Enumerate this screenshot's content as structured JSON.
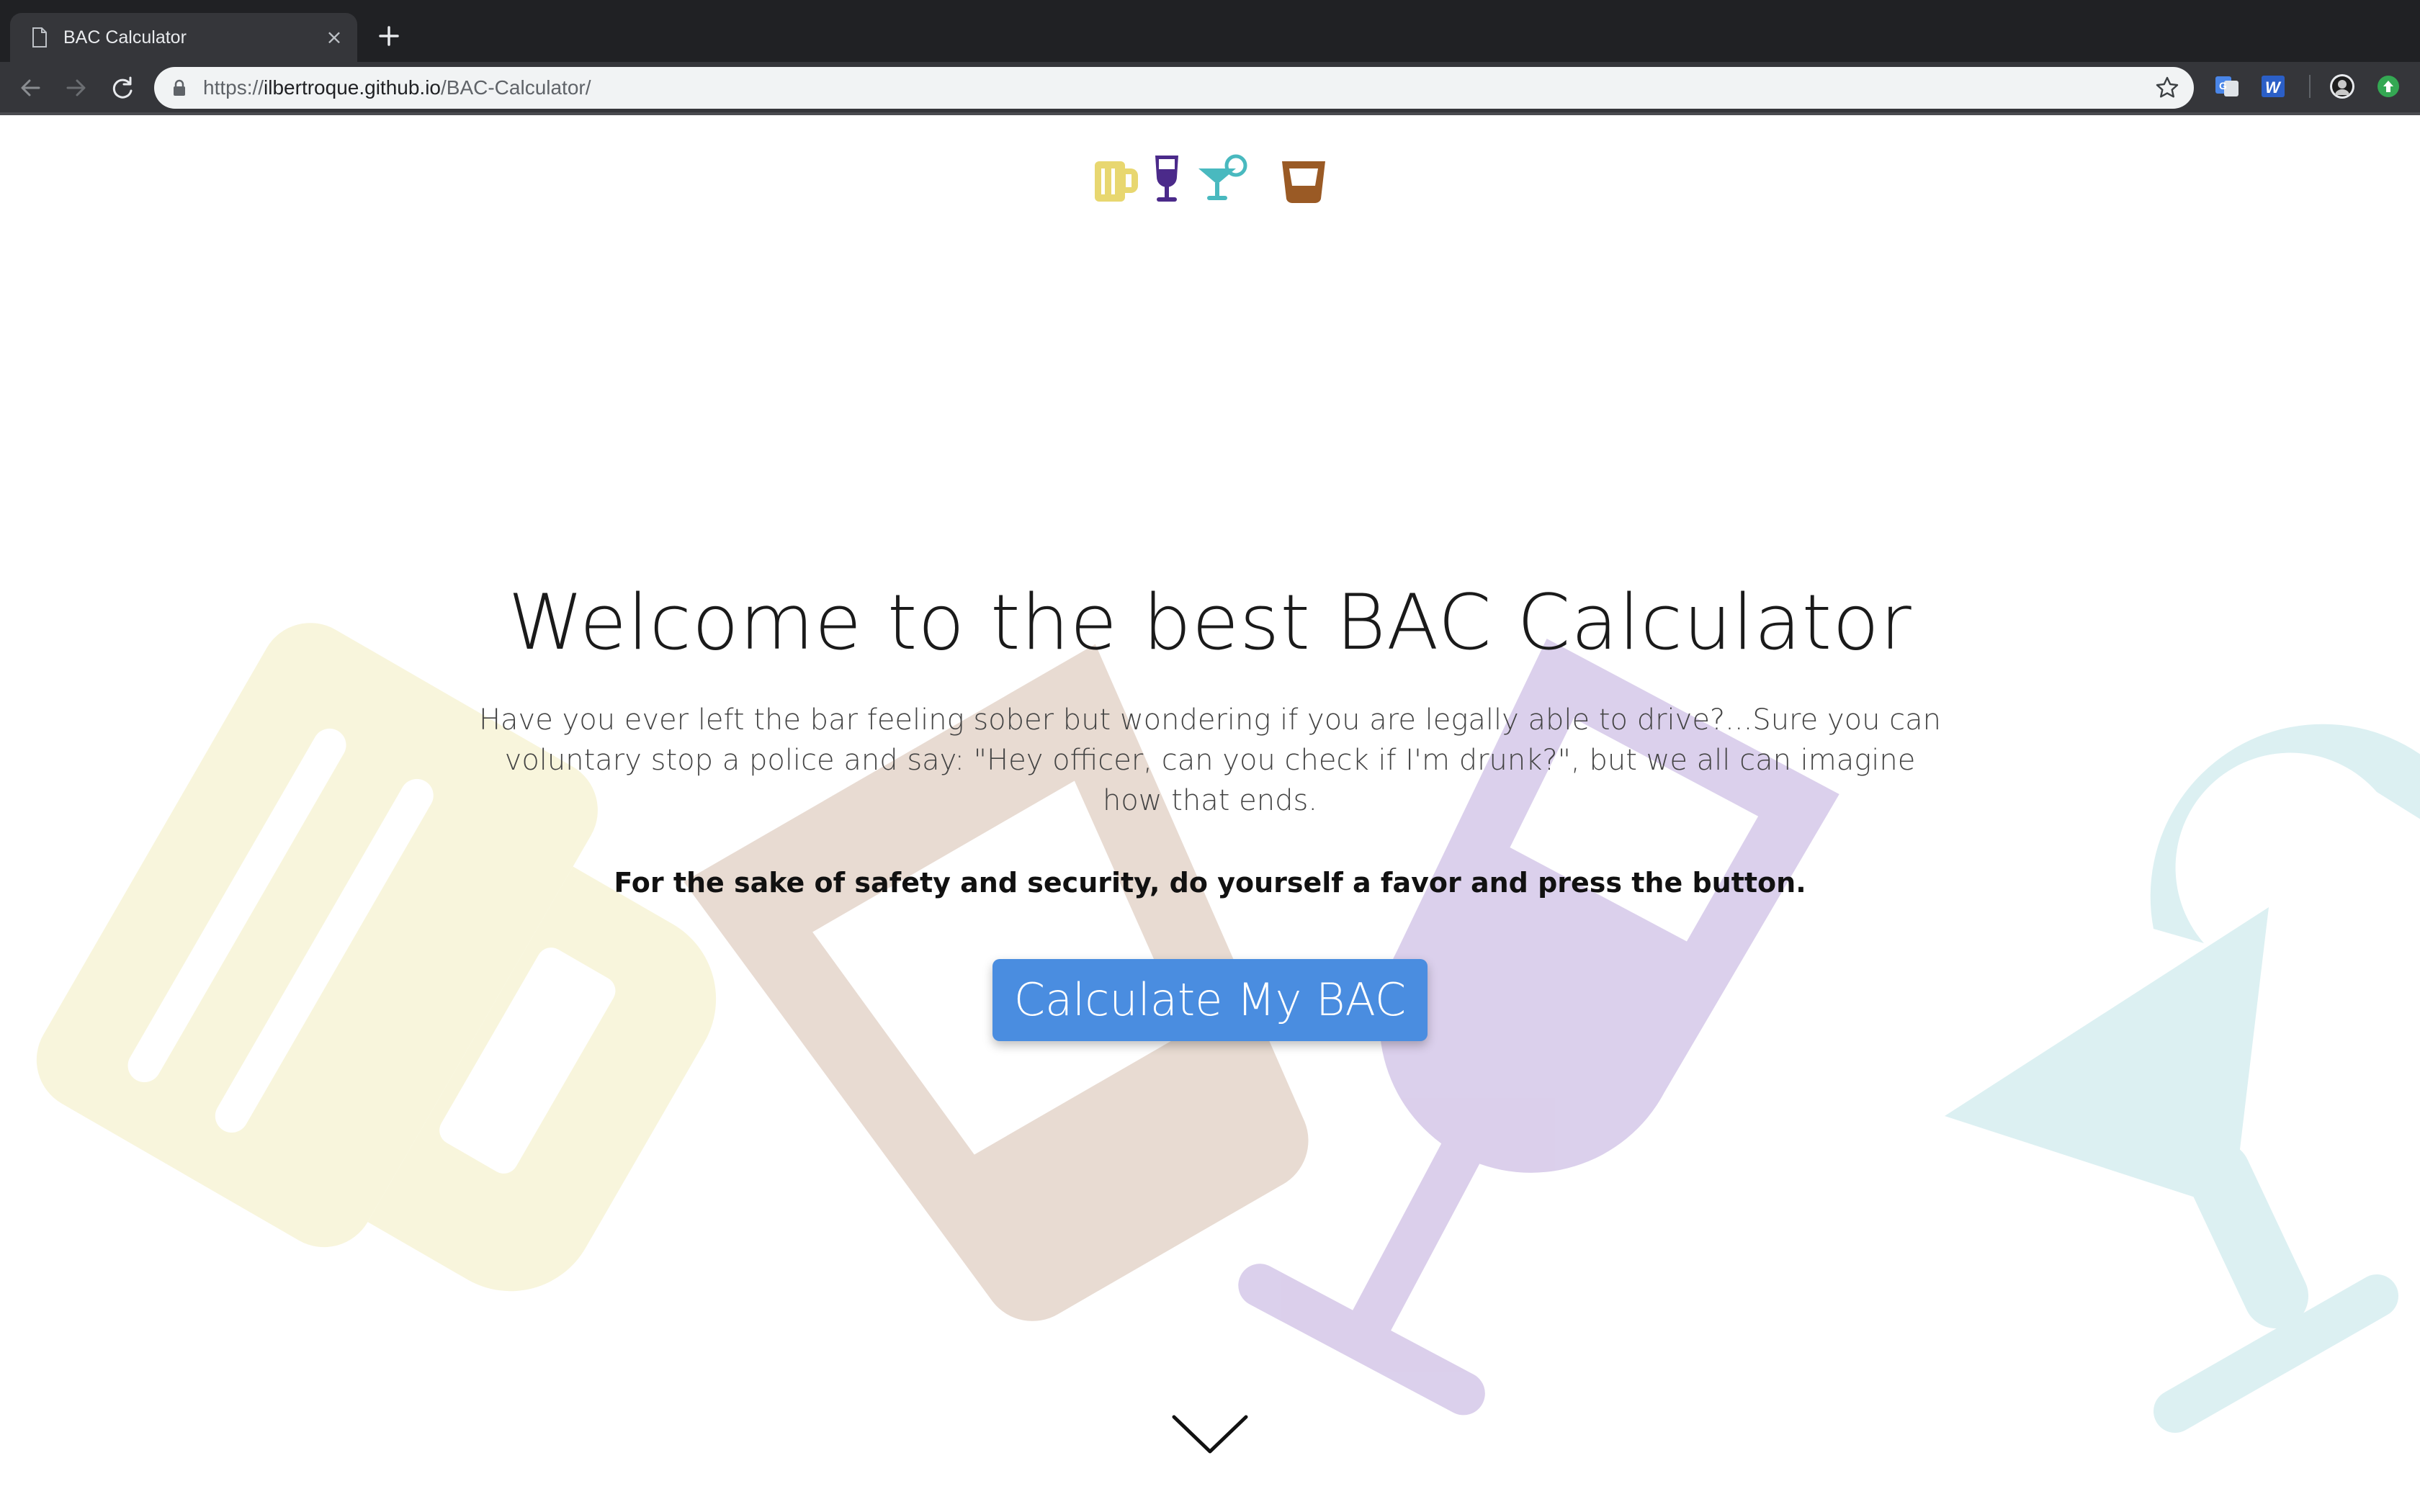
{
  "browser": {
    "tab_title": "BAC Calculator",
    "tab_close_glyph": "×",
    "new_tab_icon": "plus-icon",
    "url_scheme": "https://",
    "url_host": "ilbertroque.github.io",
    "url_path": "/BAC-Calculator/",
    "extensions": [
      "google-translate-icon",
      "word-icon",
      "profile-avatar",
      "update-icon"
    ]
  },
  "header": {
    "icons": [
      "beer-mug-icon",
      "wine-glass-icon",
      "cocktail-icon",
      "whiskey-glass-icon"
    ]
  },
  "hero": {
    "title": "Welcome to the best BAC Calculator",
    "text": "Have you ever left the bar feeling sober but wondering if you are legally able to drive?...Sure you can voluntary stop a police and say: \"Hey officer, can you check if I'm drunk?\", but we all can imagine how that ends.",
    "emphasis": "For the sake of safety and security, do yourself a favor and press the button.",
    "button_label": "Calculate My BAC"
  },
  "colors": {
    "beer": "#e8d770",
    "wine": "#4b2a8a",
    "cocktail": "#49b9bf",
    "whiskey": "#9a5a25",
    "button": "#4a8de0"
  }
}
